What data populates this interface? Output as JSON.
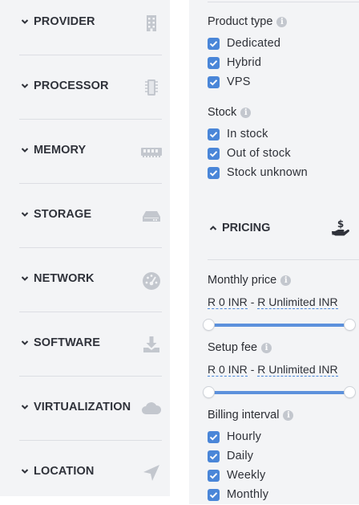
{
  "left_panel": {
    "items": [
      {
        "label": "PROVIDER",
        "icon": "building-icon"
      },
      {
        "label": "PROCESSOR",
        "icon": "cpu-icon"
      },
      {
        "label": "MEMORY",
        "icon": "ram-icon"
      },
      {
        "label": "STORAGE",
        "icon": "hard-drive-icon"
      },
      {
        "label": "NETWORK",
        "icon": "speedometer-icon"
      },
      {
        "label": "SOFTWARE",
        "icon": "download-icon"
      },
      {
        "label": "VIRTUALIZATION",
        "icon": "cloud-icon"
      },
      {
        "label": "LOCATION",
        "icon": "location-arrow-icon"
      }
    ]
  },
  "right_panel": {
    "product_type": {
      "title": "Product type",
      "options": [
        {
          "label": "Dedicated",
          "checked": true
        },
        {
          "label": "Hybrid",
          "checked": true
        },
        {
          "label": "VPS",
          "checked": true
        }
      ]
    },
    "stock": {
      "title": "Stock",
      "options": [
        {
          "label": "In stock",
          "checked": true
        },
        {
          "label": "Out of stock",
          "checked": true
        },
        {
          "label": "Stock unknown",
          "checked": true
        }
      ]
    },
    "pricing": {
      "title": "PRICING",
      "icon": "hand-dollar-icon",
      "monthly_price": {
        "title": "Monthly price",
        "min": "R 0 INR",
        "separator": "-",
        "max": "R Unlimited INR"
      },
      "setup_fee": {
        "title": "Setup fee",
        "min": "R 0 INR",
        "separator": "-",
        "max": "R Unlimited INR"
      }
    },
    "billing_interval": {
      "title": "Billing interval",
      "options": [
        {
          "label": "Hourly",
          "checked": true
        },
        {
          "label": "Daily",
          "checked": true
        },
        {
          "label": "Weekly",
          "checked": true
        },
        {
          "label": "Monthly",
          "checked": true
        }
      ]
    }
  },
  "colors": {
    "accent": "#4a86d8",
    "panel_bg": "#f3f4f6",
    "icon_gray": "#c3c7ce"
  }
}
